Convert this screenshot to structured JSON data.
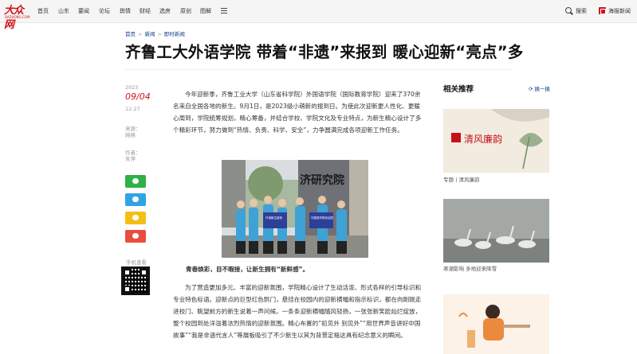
{
  "nav": {
    "logo": "大众网",
    "logo_sub": "DAZHONG.COM",
    "items": [
      "首页",
      "山东",
      "要闻",
      "论坛",
      "舆情",
      "财经",
      "选房",
      "原创",
      "图解"
    ],
    "search": "搜索",
    "poster": "海报新闻"
  },
  "breadcrumb": [
    "首页",
    "新闻",
    "即时新闻"
  ],
  "article": {
    "title": "齐鲁工大外语学院 带着“非遗”来报到 暖心迎新“亮点”多",
    "year": "2023",
    "date": "09/04",
    "time": "12:27",
    "source_label": "来源：",
    "source": "网络",
    "author_label": "作者：",
    "author": "朱萍",
    "qr_label": "手机查看",
    "para1": "今年迎新季，齐鲁工业大学（山东省科学院）外国语学院（国际教育学院）迎来了370余名来自全国各地的新生。9月1日，是2023级小萌新的报到日。为使此次迎新更人性化、更暖心周到，学院统筹规划，精心筹备，并结合学校、学院文化及专业特点，为新生精心设计了多个精彩环节，努力做到“热情、负责、科学、安全”，力争圆满完成各项迎新工作任务。",
    "photo_signs": [
      "外语新生报到",
      "外国语学院欢迎您"
    ],
    "photo_building_text": "济研究院",
    "caption": "青春焕彩，目不暇接，让新生拥有“新鲜感”。",
    "para2": "为了营造更加多元、丰富的迎新氛围，学院精心设计了生动活泼、形式各样的引导标识和专业特色标语。迎新点的巨型红色拱门，悬挂在校园内的迎新横幅和指示标识，都在向刚刚走进校门、眺望前方的新生说着一声问候。一条条迎新横幅随风轻扬，一张张新笑脸灿烂绽放，整个校园到处洋溢着浓烈热情的迎新氛围。精心布置的“初见外 别见外”“用世界声音讲好中国故事”“我是非遗代言人”等展板吸引了不少新生以其为背景定格这具有纪念意义的瞬间。"
  },
  "sidebar": {
    "title": "相关推荐",
    "refresh": "换一换",
    "cards": [
      {
        "img_text": "清风廉韵",
        "caption": "专题丨清风廉韵"
      },
      {
        "caption": "寒潮影响 多地迎来降雪"
      },
      {
        "caption": ""
      }
    ]
  },
  "colors": {
    "brand_red": "#d0121b",
    "link_blue": "#0d3b8c",
    "wechat": "#2eb145",
    "qq": "#30a3e6",
    "qzone": "#f4bf14",
    "weibo": "#e84e40"
  },
  "icons": [
    "menu-icon",
    "search-icon",
    "poster-icon",
    "wechat-icon",
    "qq-icon",
    "qzone-icon",
    "weibo-icon",
    "refresh-icon"
  ]
}
